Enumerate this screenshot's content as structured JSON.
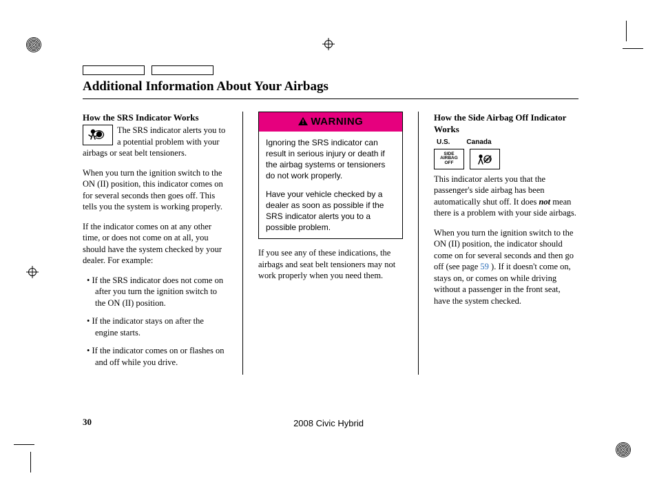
{
  "page_title": "Additional Information About Your Airbags",
  "page_number": "30",
  "footer": "2008  Civic  Hybrid",
  "col1": {
    "heading": "How the SRS Indicator Works",
    "p1": "The SRS indicator alerts you to a potential problem with your airbags or seat belt tensioners.",
    "p2": "When you turn the ignition switch to the ON (II) position, this indicator comes on for several seconds then goes off. This tells you the system is working properly.",
    "p3": "If the indicator comes on at any other time, or does not come on at all, you should have the system checked by your dealer. For example:",
    "li1": "If the SRS indicator does not come on after you turn the ignition switch to the ON (II) position.",
    "li2": "If the indicator stays on after the engine starts.",
    "li3": "If the indicator comes on or flashes on and off while you drive."
  },
  "col2": {
    "warning_label": "WARNING",
    "warning_p1": "Ignoring the SRS indicator can result in serious injury or death if the airbag systems or tensioners do not work properly.",
    "warning_p2": "Have your vehicle checked by a dealer as soon as possible if the SRS indicator alerts you to a possible problem.",
    "after": "If you see any of these indications, the airbags and seat belt tensioners may not work properly when you need them."
  },
  "col3": {
    "heading": "How the Side Airbag Off Indicator Works",
    "region_us": "U.S.",
    "region_ca": "Canada",
    "side_label": "SIDE\nAIRBAG\nOFF",
    "p1a": "This indicator alerts you that the passenger's side airbag has been automatically shut off. It does ",
    "p1_not": "not",
    "p1b": " mean there is a problem with your side airbags.",
    "p2a": "When you turn the ignition switch to the ON (II) position, the indicator should come on for several seconds and then go off (see page ",
    "p2_ref": "59",
    "p2b": " ). If it doesn't come on, stays on, or comes on while driving without a passenger in the front seat, have the system checked."
  }
}
